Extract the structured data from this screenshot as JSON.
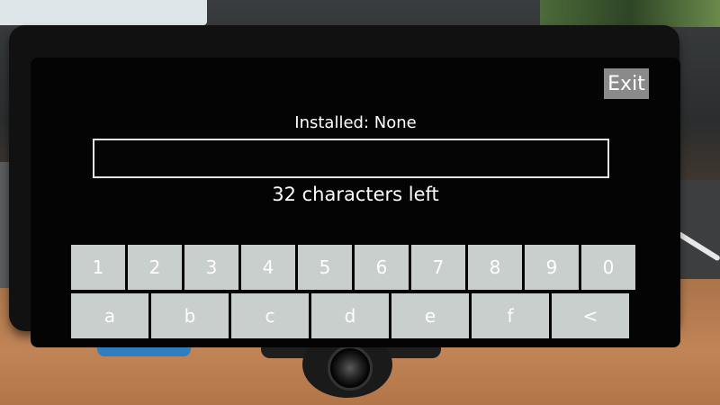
{
  "screen": {
    "exit_label": "Exit",
    "status": "Installed: None",
    "input_value": "",
    "chars_left": "32 characters left"
  },
  "keyboard": {
    "numbers": [
      "1",
      "2",
      "3",
      "4",
      "5",
      "6",
      "7",
      "8",
      "9",
      "0"
    ],
    "letters": [
      "a",
      "b",
      "c",
      "d",
      "e",
      "f",
      "<"
    ]
  }
}
